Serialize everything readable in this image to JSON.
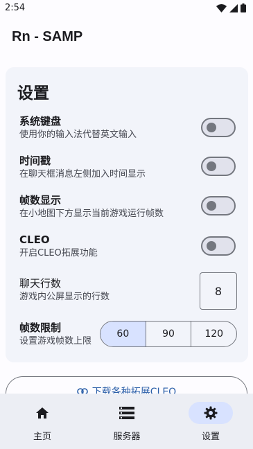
{
  "status_bar": {
    "time": "2:54",
    "icons": [
      "wifi-icon",
      "signal-icon",
      "battery-icon"
    ]
  },
  "app_bar": {
    "title": "Rn - SAMP"
  },
  "settings": {
    "title": "设置",
    "items": [
      {
        "title": "系统键盘",
        "subtitle": "使用你的输入法代替英文输入",
        "enabled": false
      },
      {
        "title": "时间戳",
        "subtitle": "在聊天框消息左侧加入时间显示",
        "enabled": false
      },
      {
        "title": "帧数显示",
        "subtitle": "在小地图下方显示当前游戏运行帧数",
        "enabled": false
      },
      {
        "title": "CLEO",
        "subtitle": "开启CLEO拓展功能",
        "enabled": false
      }
    ],
    "chat_lines": {
      "title": "聊天行数",
      "subtitle": "游戏内公屏显示的行数",
      "value": "8"
    },
    "fps_limit": {
      "title": "帧数限制",
      "subtitle": "设置游戏帧数上限",
      "options": [
        "60",
        "90",
        "120"
      ],
      "selected": "60"
    }
  },
  "download_button": {
    "label": "下载各种拓展CLEO"
  },
  "bottom_nav": {
    "items": [
      {
        "label": "主页",
        "icon": "home-icon",
        "active": false
      },
      {
        "label": "服务器",
        "icon": "server-icon",
        "active": false
      },
      {
        "label": "设置",
        "icon": "gear-icon",
        "active": true
      }
    ]
  },
  "colors": {
    "accent": "#2a5ea8",
    "selected_bg": "#d8e2ff",
    "card_bg": "#f2f4fa"
  }
}
